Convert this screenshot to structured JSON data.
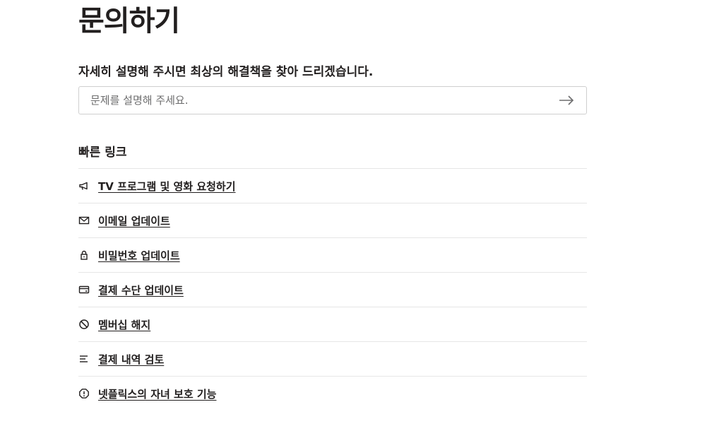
{
  "page": {
    "title": "문의하기",
    "subtitle": "자세히 설명해 주시면 최상의 해결책을 찾아 드리겠습니다."
  },
  "search": {
    "placeholder": "문제를 설명해 주세요.",
    "value": "",
    "submit_icon": "arrow-right-icon"
  },
  "quick_links": {
    "title": "빠른 링크",
    "items": [
      {
        "label": "TV 프로그램 및 영화 요청하기",
        "icon": "megaphone-icon"
      },
      {
        "label": "이메일 업데이트",
        "icon": "envelope-icon"
      },
      {
        "label": "비밀번호 업데이트",
        "icon": "lock-icon"
      },
      {
        "label": "결제 수단 업데이트",
        "icon": "credit-card-icon"
      },
      {
        "label": "멤버십 해지",
        "icon": "cancel-icon"
      },
      {
        "label": "결제 내역 검토",
        "icon": "list-icon"
      },
      {
        "label": "넷플릭스의 자녀 보호 기능",
        "icon": "alert-icon"
      }
    ]
  },
  "colors": {
    "text": "#221f1f",
    "border": "#cfcfcf",
    "divider": "#e6e6e6",
    "placeholder": "#6d6d6e"
  }
}
